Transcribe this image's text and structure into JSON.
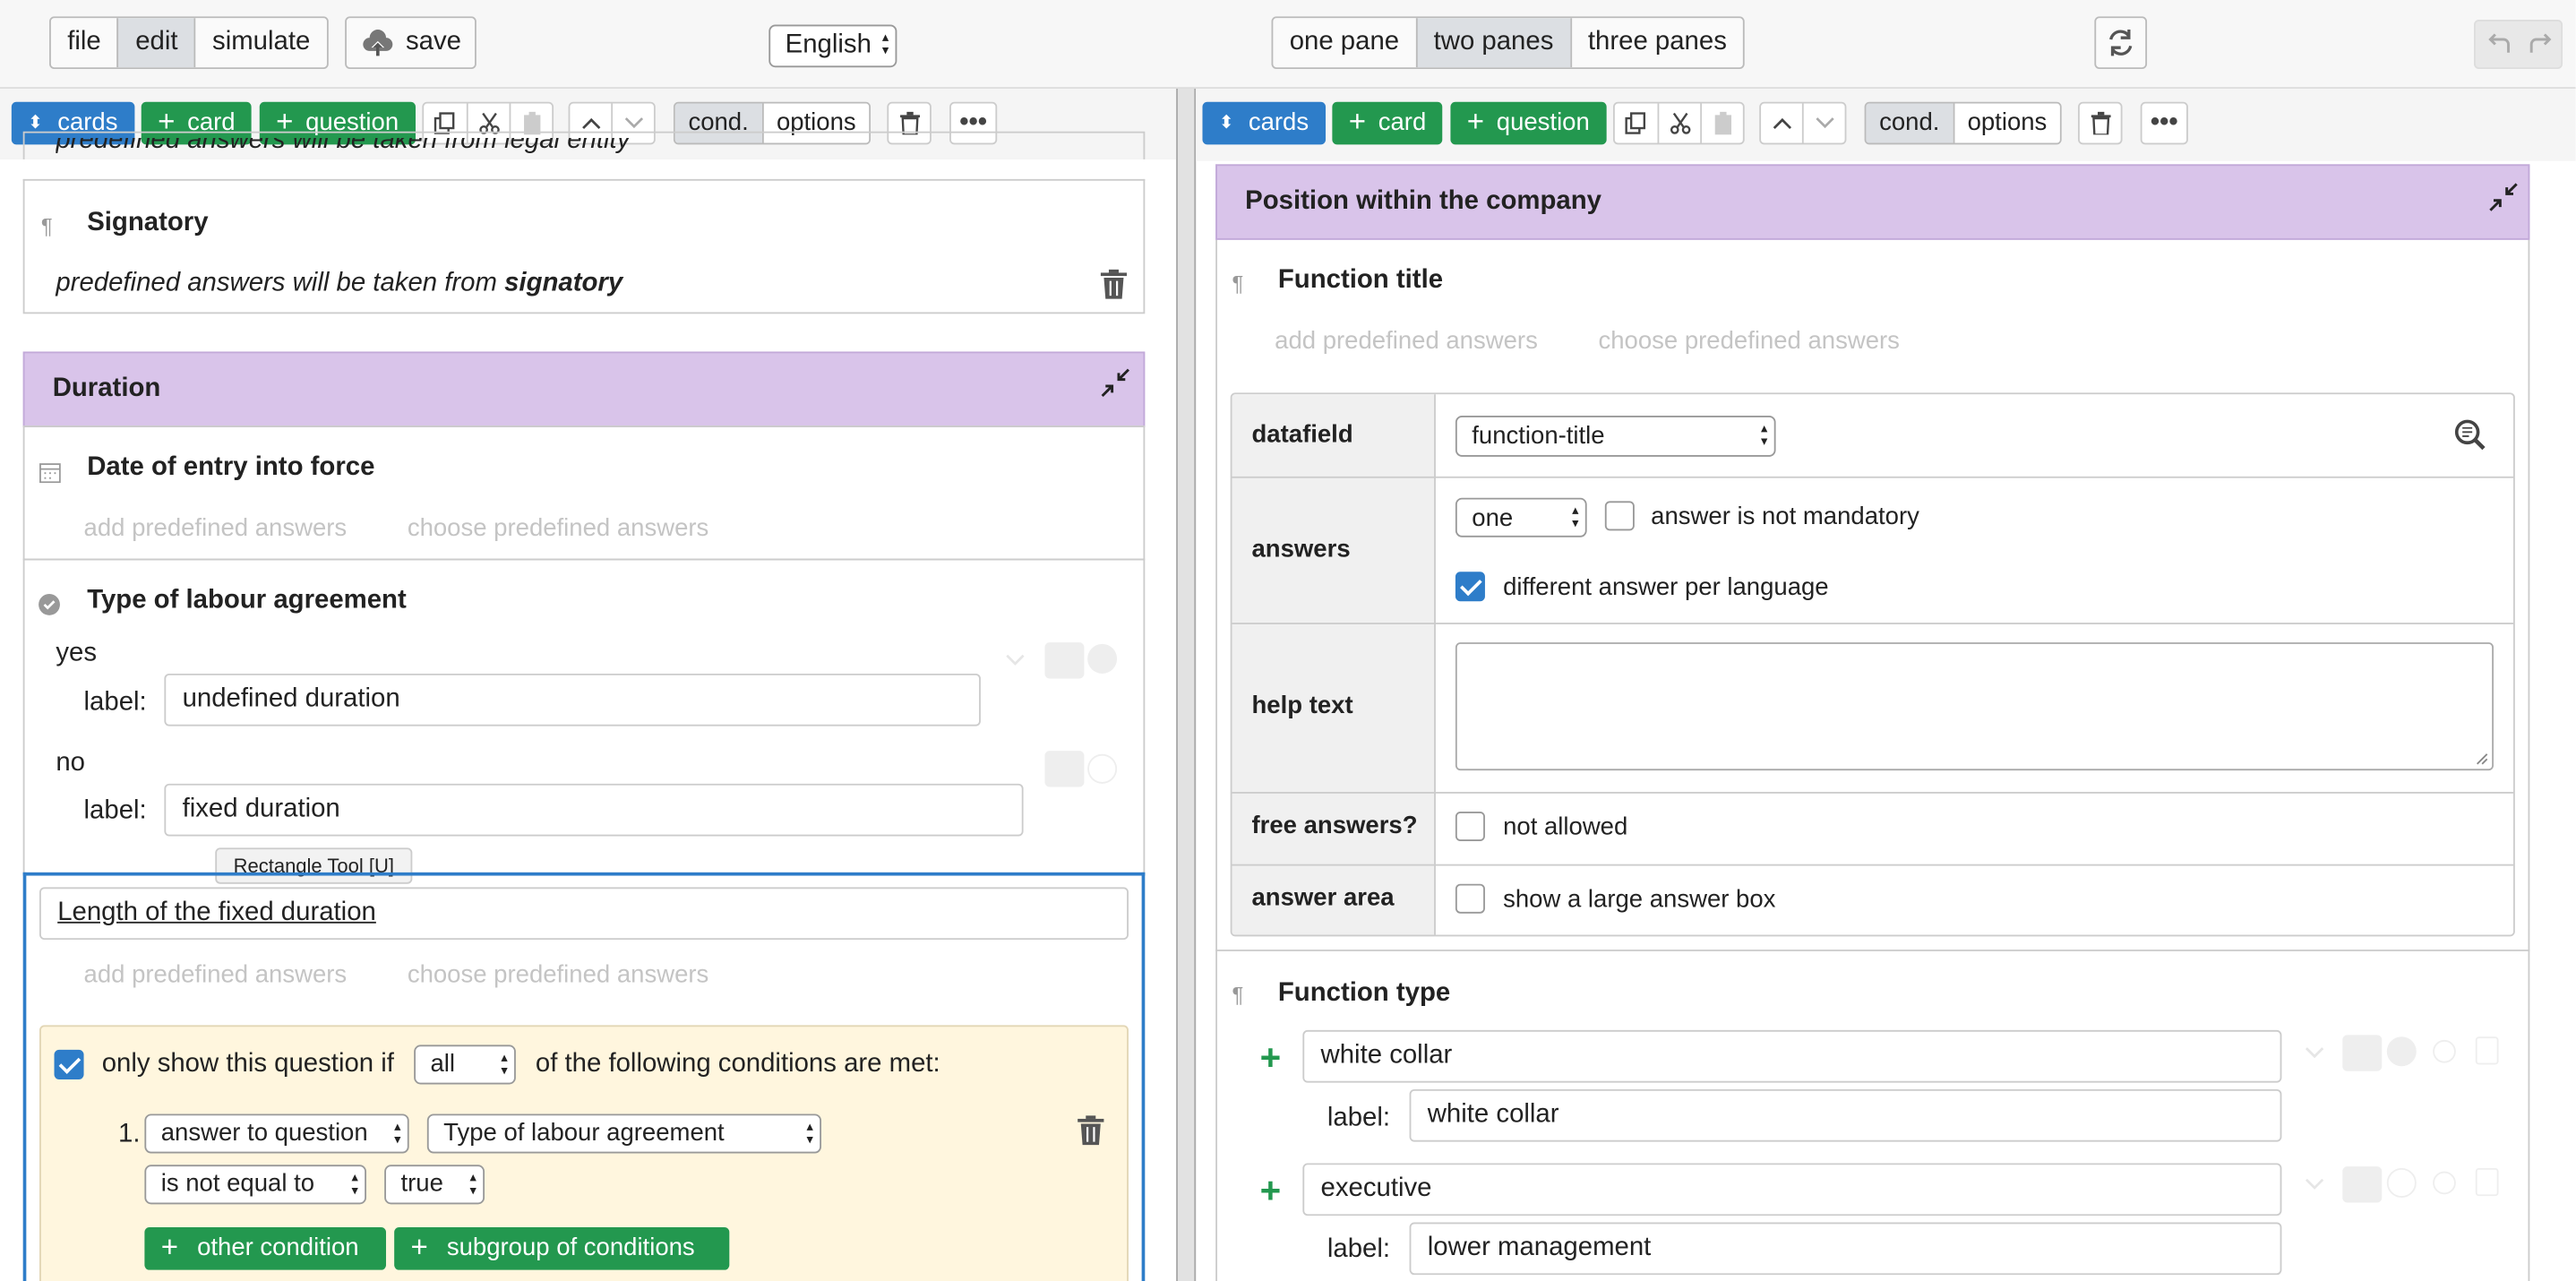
{
  "menu": {
    "file": "file",
    "edit": "edit",
    "simulate": "simulate",
    "save": "save"
  },
  "language": "English",
  "panes": {
    "one": "one pane",
    "two": "two panes",
    "three": "three panes"
  },
  "toolbar": {
    "cards": "cards",
    "card": "card",
    "question": "question",
    "cond": "cond.",
    "options": "options"
  },
  "left": {
    "top_partial": "predefined answers will be taken from legal entity",
    "signatory": {
      "title": "Signatory",
      "text_prefix": "predefined answers will be taken from ",
      "text_bold": "signatory"
    },
    "duration": {
      "title": "Duration"
    },
    "date_entry": {
      "title": "Date of entry into force",
      "add": "add predefined answers",
      "choose": "choose predefined answers"
    },
    "labour": {
      "title": "Type of labour agreement",
      "yes": "yes",
      "yes_label": "label:",
      "yes_value": "undefined duration",
      "no": "no",
      "no_label": "label:",
      "no_value": "fixed duration"
    },
    "tooltip": "Rectangle Tool [U]",
    "length": {
      "title": "Length of the fixed duration",
      "add": "add predefined answers",
      "choose": "choose predefined answers"
    },
    "condition": {
      "prefix": "only show this question if",
      "mode": "all",
      "suffix": "of the following conditions are met:",
      "index": "1.",
      "type": "answer to question",
      "question": "Type of labour agreement",
      "op": "is not equal to",
      "value": "true",
      "other": "other condition",
      "subgroup": "subgroup of conditions"
    }
  },
  "right": {
    "position": {
      "title": "Position within the company"
    },
    "function_title": {
      "title": "Function title",
      "add": "add predefined answers",
      "choose": "choose predefined answers"
    },
    "props": {
      "datafield_label": "datafield",
      "datafield_value": "function-title",
      "answers_label": "answers",
      "answers_count": "one",
      "not_mandatory": "answer is not mandatory",
      "per_language": "different answer per language",
      "help_label": "help text",
      "free_label": "free answers?",
      "free_value": "not allowed",
      "area_label": "answer area",
      "area_value": "show a large answer box"
    },
    "function_type": {
      "title": "Function type",
      "opt1": "white collar",
      "opt1_label_key": "label:",
      "opt1_label": "white collar",
      "opt2": "executive",
      "opt2_label_key": "label:",
      "opt2_label": "lower management"
    }
  },
  "colors": {
    "accent_blue": "#2e7dc9",
    "green": "#23984f",
    "card_header": "#d9c4ea",
    "condition_bg": "#fff6de"
  }
}
